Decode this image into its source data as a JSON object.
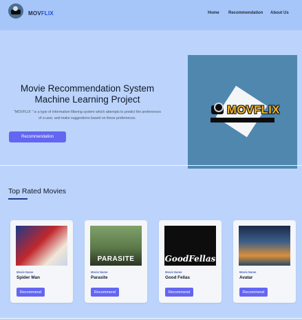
{
  "navbar": {
    "brand_mov": "MOV",
    "brand_flix": "FLIX",
    "links": [
      "Home",
      "Recommendation",
      "About Us"
    ]
  },
  "hero": {
    "title": "Movie Recommendation System Machine Learning Project",
    "description": "\"MOVFLIX \" is a type of information filtering system which attempts to predict the preferences of a user, and make suggestions based on these preferences.",
    "button_label": "Recommendation",
    "image_wordmark": "MOVFLIX"
  },
  "section": {
    "title": "Top Rated Movies"
  },
  "movies": [
    {
      "label": "Movie Name",
      "name": "Spider Man",
      "button": "Recommend"
    },
    {
      "label": "Movie Name",
      "name": "Parasite",
      "button": "Recommend",
      "poster_text": "PARASITE"
    },
    {
      "label": "Movie Name",
      "name": "Good Fellas",
      "button": "Recommend",
      "poster_text": "GoodFellas"
    },
    {
      "label": "Movie Name",
      "name": "Avatar",
      "button": "Recommend"
    }
  ],
  "colors": {
    "page_background": "#bcd4fb",
    "navbar": "#a6c6fa",
    "accent": "#6366f1",
    "brand_accent": "#1d4ed8"
  }
}
